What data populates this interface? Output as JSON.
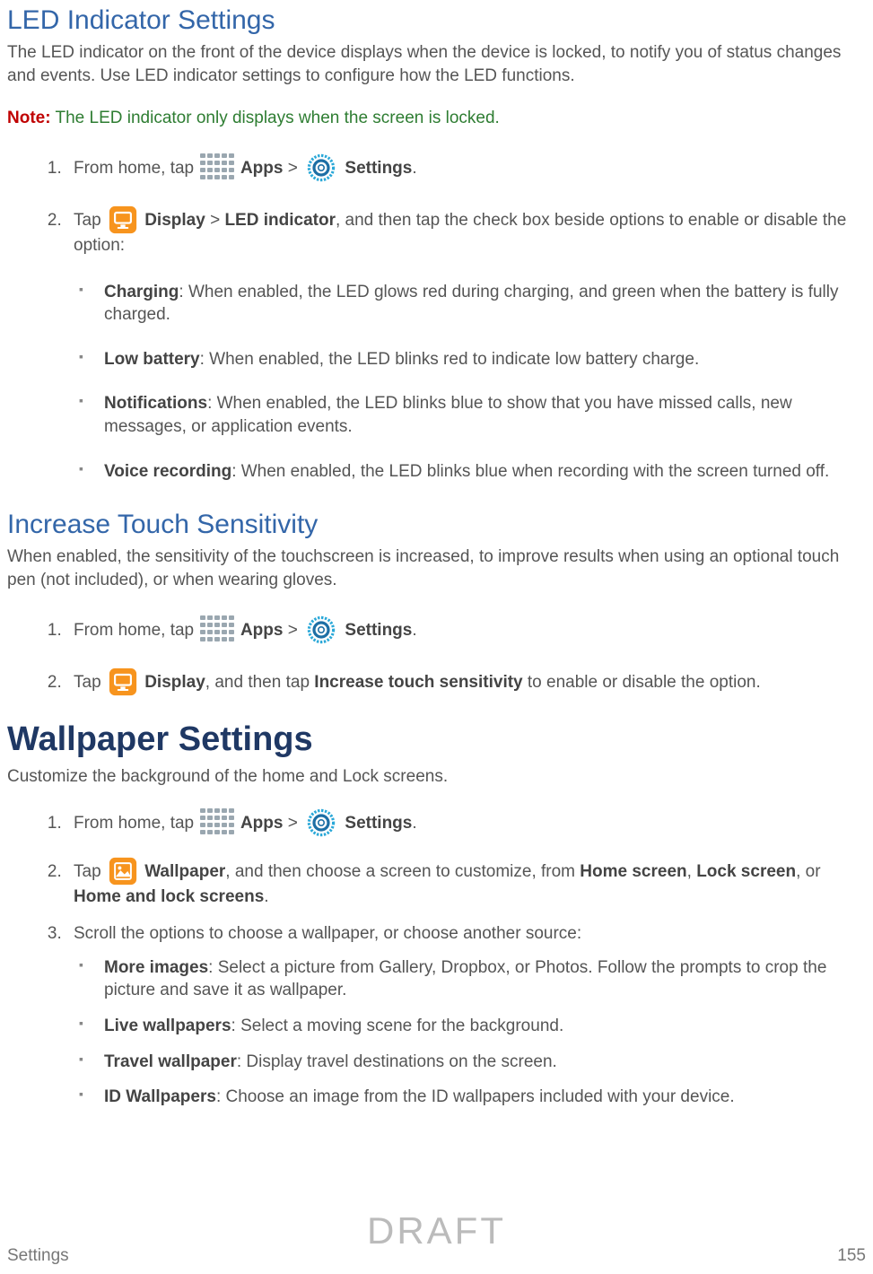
{
  "sec1": {
    "title": "LED Indicator Settings",
    "desc": "The LED indicator on the front of the device displays when the device is locked, to notify you of status changes and events. Use LED indicator settings to configure how the LED functions.",
    "note_label": "Note:",
    "note_text": " The LED indicator only displays when the screen is locked.",
    "step1_a": "From home, tap ",
    "step1_b": " Apps",
    "step1_c": " > ",
    "step1_d": " Settings",
    "step1_e": ".",
    "step2_a": "Tap ",
    "step2_b": " Display",
    "step2_c": " > ",
    "step2_d": "LED indicator",
    "step2_e": ", and then tap the check box beside options to enable or disable the option:",
    "sub1_b": "Charging",
    "sub1_r": ": When enabled, the LED glows red during charging, and green when the battery is fully charged.",
    "sub2_b": "Low battery",
    "sub2_r": ": When enabled, the LED blinks red to indicate low battery charge.",
    "sub3_b": "Notifications",
    "sub3_r": ": When enabled, the LED blinks blue to show that you have missed calls, new messages, or application events.",
    "sub4_b": "Voice recording",
    "sub4_r": ": When enabled, the LED blinks blue when recording with the screen turned off."
  },
  "sec2": {
    "title": "Increase Touch Sensitivity",
    "desc": "When enabled, the sensitivity of the touchscreen is increased, to improve results when using an optional touch pen (not included), or when wearing gloves.",
    "step1_a": "From home, tap ",
    "step1_b": " Apps",
    "step1_c": " > ",
    "step1_d": " Settings",
    "step1_e": ".",
    "step2_a": "Tap ",
    "step2_b": " Display",
    "step2_c": ", and then tap ",
    "step2_d": "Increase touch sensitivity",
    "step2_e": " to enable or disable the option."
  },
  "sec3": {
    "title": "Wallpaper Settings",
    "desc": "Customize the background of the home and Lock screens.",
    "step1_a": "From home, tap ",
    "step1_b": " Apps",
    "step1_c": " > ",
    "step1_d": " Settings",
    "step1_e": ".",
    "step2_a": "Tap ",
    "step2_b": " Wallpaper",
    "step2_c": ", and then choose a screen to customize, from ",
    "step2_d": "Home screen",
    "step2_e": ", ",
    "step2_f": "Lock screen",
    "step2_g": ", or ",
    "step2_h": "Home and lock screens",
    "step2_i": ".",
    "step3": "Scroll the options to choose a wallpaper, or choose another source:",
    "sub1_b": "More images",
    "sub1_r": ": Select a picture from Gallery, Dropbox, or Photos. Follow the prompts to crop the picture and save it as wallpaper.",
    "sub2_b": "Live wallpapers",
    "sub2_r": ": Select a moving scene for the background.",
    "sub3_b": "Travel wallpaper",
    "sub3_r": ": Display travel destinations on the screen.",
    "sub4_b": "ID Wallpapers",
    "sub4_r": ": Choose an image from the ID wallpapers included with your device."
  },
  "watermark": "DRAFT",
  "footer_left": "Settings",
  "footer_right": "155"
}
